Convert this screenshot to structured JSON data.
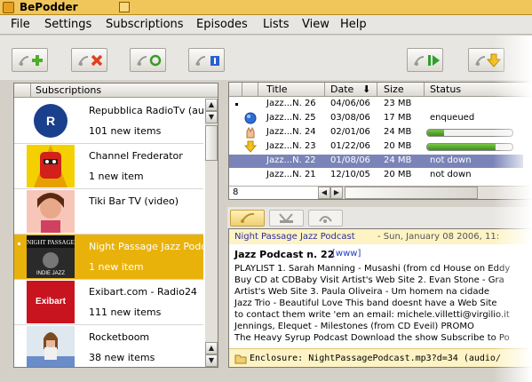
{
  "window": {
    "title": "BePodder"
  },
  "menu": [
    "File",
    "Settings",
    "Subscriptions",
    "Episodes",
    "Lists",
    "View",
    "Help"
  ],
  "subscriptions": {
    "header": "Subscriptions",
    "items": [
      {
        "title": "Repubblica RadioTv (audio)",
        "count": "101 new items",
        "thumb": "repubblica-logo"
      },
      {
        "title": "Channel Frederator",
        "count": "1 new item",
        "thumb": "red-robot-logo"
      },
      {
        "title": "Tiki Bar TV (video)",
        "count": "",
        "thumb": "tiki-bar-photo"
      },
      {
        "title": "Night Passage Jazz Podcast",
        "count": "1 new item",
        "thumb": "night-passage-logo",
        "selected": true
      },
      {
        "title": "Exibart.com -  Radio24",
        "count": "111 new items",
        "thumb": "exibart-logo"
      },
      {
        "title": "Rocketboom",
        "count": "38 new items",
        "thumb": "rocketboom-photo"
      }
    ]
  },
  "episodes": {
    "columns": [
      "Title",
      "Date",
      "Size",
      "Status"
    ],
    "count": "8",
    "rows": [
      {
        "icon": "bullet",
        "title": "Jazz...N. 26",
        "date": "04/06/06",
        "size": "23 MB",
        "status": ""
      },
      {
        "icon": "blue-orb",
        "title": "Jazz...N. 25",
        "date": "03/08/06",
        "size": "17 MB",
        "status": "enqueued"
      },
      {
        "icon": "hand",
        "title": "Jazz...N. 24",
        "date": "02/01/06",
        "size": "24 MB",
        "status": "",
        "progress": 0.2
      },
      {
        "icon": "download-arrow",
        "title": "Jazz...N. 23",
        "date": "01/22/06",
        "size": "20 MB",
        "status": "",
        "progress": 0.8
      },
      {
        "icon": "",
        "title": "Jazz...N. 22",
        "date": "01/08/06",
        "size": "24 MB",
        "status": "not down",
        "selected": true
      },
      {
        "icon": "",
        "title": "Jazz...N. 21",
        "date": "12/10/05",
        "size": "20 MB",
        "status": "not down"
      }
    ]
  },
  "detail": {
    "feed": "Night Passage Jazz Podcast",
    "date": "- Sun, January 08 2006, 11:",
    "ep_title": "Jazz Podcast n. 22",
    "link": "[www]",
    "lines": [
      "PLAYLIST  1. Sarah Manning - Musashi (from cd House on Eddy",
      "Buy CD at CDBaby  Visit Artist's Web Site  2. Evan Stone - Gra",
      "Artist's Web Site  3. Paula Oliveira - Um homem na cidade",
      "Jazz Trio - Beautiful Love        This band doesnt have a Web Site",
      "to contact them write 'em an email:  michele.villetti@virgilio.it",
      "Jennings, Elequet - Milestones (from CD Eveil)            PROMO",
      "The Heavy Syrup Podcast    Download the show   Subscribe to Po"
    ],
    "enclosure": "Enclosure: NightPassagePodcast.mp3?d=34 (audio/"
  }
}
